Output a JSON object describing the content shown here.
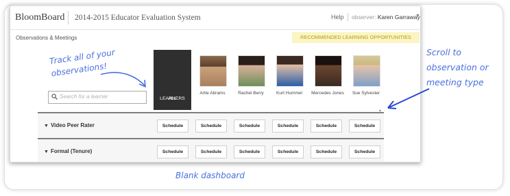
{
  "header": {
    "brand": "BloomBoard",
    "system_name": "2014-2015 Educator Evaluation System",
    "help": "Help",
    "observer_label": "observer:",
    "observer_name": "Karen Garraway"
  },
  "breadcrumb": "Observations & Meetings",
  "recommended": "RECOMMENDED LEARNING OPPORTUNITIES",
  "search": {
    "placeholder": "Search for a learner"
  },
  "all_learners": [
    "ALL",
    "LEARNERS"
  ],
  "learners": [
    {
      "name": "Artie Abrams"
    },
    {
      "name": "Rachel Berry"
    },
    {
      "name": "Kurt Hummel"
    },
    {
      "name": "Mercedes Jones"
    },
    {
      "name": "Sue Sylvester"
    }
  ],
  "rows": [
    {
      "label": "Video Peer Rater",
      "buttons": [
        "Schedule",
        "Schedule",
        "Schedule",
        "Schedule",
        "Schedule",
        "Schedule"
      ]
    },
    {
      "label": "Formal (Tenure)",
      "buttons": [
        "Schedule",
        "Schedule",
        "Schedule",
        "Schedule",
        "Schedule",
        "Schedule"
      ]
    }
  ],
  "annotations": {
    "track": [
      "Track all of your",
      "observations!"
    ],
    "scroll": [
      "Scroll to",
      "observation or",
      "meeting type"
    ],
    "caption": "Blank dashboard"
  },
  "colors": {
    "accent_hand": "#4a6fe0",
    "rlo_bg": "#fbf5c4",
    "rlo_text": "#b89a14",
    "all_bg": "#2f2f2f"
  }
}
